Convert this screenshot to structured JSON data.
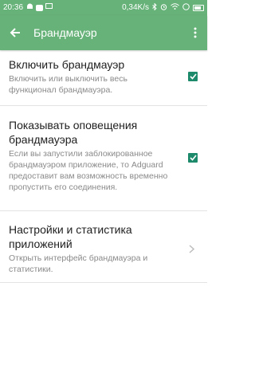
{
  "status_bar": {
    "time": "20:36",
    "network_speed": "0,34K/s"
  },
  "app_bar": {
    "title": "Брандмауэр"
  },
  "settings": [
    {
      "title": "Включить брандмауэр",
      "summary": "Включить или выключить весь функционал брандмауэра.",
      "control": "checkbox",
      "checked": true
    },
    {
      "title": "Показывать оповещения брандмауэра",
      "summary": "Если вы запустили заблокированное брандмауэром приложение, то Adguard предоставит вам возможность временно пропустить его соединения.",
      "control": "checkbox",
      "checked": true
    },
    {
      "title": "Настройки и статистика приложений",
      "summary": "Открыть интерфейс брандмауэра и статистики.",
      "control": "chevron"
    }
  ],
  "colors": {
    "primary": "#67b279",
    "checkbox": "#1e8a6c",
    "divider": "#e3e3e3"
  }
}
